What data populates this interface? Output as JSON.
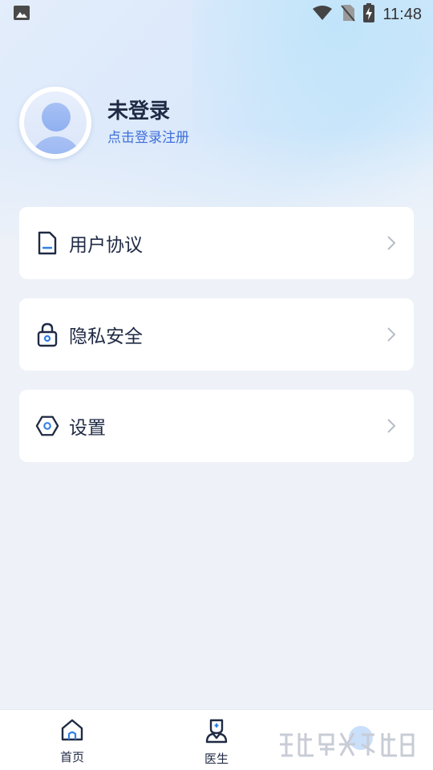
{
  "status_bar": {
    "time": "11:48",
    "icons": [
      "image-icon",
      "wifi-icon",
      "no-sim-icon",
      "battery-charging-icon"
    ]
  },
  "profile": {
    "name": "未登录",
    "subtitle": "点击登录注册",
    "avatar_icon": "user-avatar-icon"
  },
  "menu": {
    "items": [
      {
        "label": "用户协议",
        "icon": "document-icon"
      },
      {
        "label": "隐私安全",
        "icon": "lock-icon"
      },
      {
        "label": "设置",
        "icon": "settings-hexagon-icon"
      }
    ]
  },
  "bottom_nav": {
    "items": [
      {
        "label": "首页",
        "icon": "home-icon"
      },
      {
        "label": "医生",
        "icon": "doctor-icon"
      },
      {
        "label": "",
        "icon": "profile-tab-icon"
      }
    ]
  },
  "colors": {
    "accent": "#3f6fd8",
    "text_primary": "#1f2a44",
    "background": "#eef2f8",
    "card": "#ffffff",
    "nav_active": "#2f7fe8"
  }
}
